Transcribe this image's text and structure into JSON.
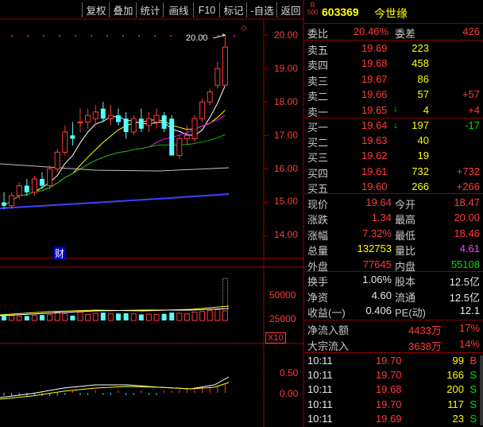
{
  "toolbar": {
    "items": [
      "复权",
      "叠加",
      "统计",
      "画线",
      "F10",
      "标记",
      "-自选",
      "返回"
    ]
  },
  "stock": {
    "badge_top": "R",
    "badge_bottom": "500",
    "code": "603369",
    "name": "今世缘"
  },
  "chart": {
    "price_axis": [
      "20.00",
      "19.00",
      "18.00",
      "17.00",
      "16.00",
      "15.00",
      "14.00"
    ],
    "high_marker": "20.00",
    "caiwu_marker": "财",
    "volume_axis": [
      "50000",
      "25000"
    ],
    "volume_unit": "X10",
    "macd_axis": [
      "0.50",
      "0.00"
    ]
  },
  "chart_data": {
    "type": "candlestick",
    "price_ylim": [
      13.6,
      20.2
    ],
    "candles": [
      {
        "o": 15.0,
        "h": 15.3,
        "l": 14.8,
        "c": 14.9
      },
      {
        "o": 14.9,
        "h": 15.3,
        "l": 14.8,
        "c": 15.2
      },
      {
        "o": 15.2,
        "h": 15.6,
        "l": 15.1,
        "c": 15.5
      },
      {
        "o": 15.5,
        "h": 15.7,
        "l": 15.2,
        "c": 15.3
      },
      {
        "o": 15.3,
        "h": 15.8,
        "l": 15.2,
        "c": 15.7
      },
      {
        "o": 15.7,
        "h": 15.9,
        "l": 15.4,
        "c": 15.5
      },
      {
        "o": 15.5,
        "h": 16.1,
        "l": 15.4,
        "c": 16.0
      },
      {
        "o": 16.0,
        "h": 16.6,
        "l": 15.9,
        "c": 16.5
      },
      {
        "o": 16.5,
        "h": 17.3,
        "l": 16.4,
        "c": 17.1
      },
      {
        "o": 17.0,
        "h": 17.4,
        "l": 16.7,
        "c": 16.9
      },
      {
        "o": 17.4,
        "h": 17.8,
        "l": 17.1,
        "c": 17.4
      },
      {
        "o": 17.4,
        "h": 17.8,
        "l": 17.2,
        "c": 17.6
      },
      {
        "o": 17.5,
        "h": 17.9,
        "l": 17.3,
        "c": 17.7
      },
      {
        "o": 17.8,
        "h": 18.0,
        "l": 17.4,
        "c": 17.5
      },
      {
        "o": 17.5,
        "h": 17.9,
        "l": 17.3,
        "c": 17.6
      },
      {
        "o": 17.6,
        "h": 17.8,
        "l": 17.3,
        "c": 17.4
      },
      {
        "o": 17.5,
        "h": 17.7,
        "l": 16.9,
        "c": 17.1
      },
      {
        "o": 17.1,
        "h": 17.6,
        "l": 17.0,
        "c": 17.5
      },
      {
        "o": 17.5,
        "h": 17.8,
        "l": 17.1,
        "c": 17.2
      },
      {
        "o": 17.3,
        "h": 17.7,
        "l": 17.1,
        "c": 17.5
      },
      {
        "o": 17.4,
        "h": 17.8,
        "l": 17.2,
        "c": 17.6
      },
      {
        "o": 17.6,
        "h": 17.7,
        "l": 17.1,
        "c": 17.2
      },
      {
        "o": 17.5,
        "h": 17.6,
        "l": 16.4,
        "c": 16.4
      },
      {
        "o": 16.4,
        "h": 17.0,
        "l": 16.3,
        "c": 16.9
      },
      {
        "o": 16.9,
        "h": 17.3,
        "l": 16.7,
        "c": 17.0
      },
      {
        "o": 16.9,
        "h": 17.6,
        "l": 16.8,
        "c": 17.5
      },
      {
        "o": 17.5,
        "h": 18.1,
        "l": 17.4,
        "c": 18.0
      },
      {
        "o": 18.0,
        "h": 18.4,
        "l": 17.9,
        "c": 18.3
      },
      {
        "o": 18.5,
        "h": 19.2,
        "l": 18.4,
        "c": 19.0
      },
      {
        "o": 18.5,
        "h": 20.0,
        "l": 18.46,
        "c": 19.64
      }
    ],
    "volumes": [
      7500,
      8000,
      7000,
      7500,
      8500,
      9000,
      9500,
      14000,
      11500,
      8000,
      14000,
      10000,
      12000,
      13000,
      11000,
      11500,
      12000,
      11000,
      10000,
      10500,
      9800,
      11000,
      13000,
      12000,
      11000,
      14000,
      15000,
      17000,
      18000,
      70000
    ],
    "volume_ylim": [
      0,
      80000
    ],
    "macd_ylim": [
      -0.3,
      0.8
    ]
  },
  "quote": {
    "weibi": {
      "label": "委比",
      "value": "20.46%",
      "label2": "委差",
      "value2": "426"
    },
    "asks": [
      {
        "label": "卖五",
        "price": "19.69",
        "vol": "223",
        "chg": ""
      },
      {
        "label": "卖四",
        "price": "19.68",
        "vol": "458",
        "chg": ""
      },
      {
        "label": "卖三",
        "price": "19.67",
        "vol": "86",
        "chg": ""
      },
      {
        "label": "卖二",
        "price": "19.66",
        "vol": "57",
        "chg": "+57"
      },
      {
        "label": "卖一",
        "price": "19.65",
        "vol": "4",
        "chg": "+4"
      }
    ],
    "bids": [
      {
        "label": "买一",
        "price": "19.64",
        "vol": "197",
        "chg": "-17"
      },
      {
        "label": "买二",
        "price": "19.63",
        "vol": "40",
        "chg": ""
      },
      {
        "label": "买三",
        "price": "19.62",
        "vol": "19",
        "chg": ""
      },
      {
        "label": "买四",
        "price": "19.61",
        "vol": "732",
        "chg": "+732"
      },
      {
        "label": "买五",
        "price": "19.60",
        "vol": "266",
        "chg": "+266"
      }
    ],
    "stats1": [
      {
        "l1": "现价",
        "v1": "19.64",
        "l2": "今开",
        "v2": "18.47"
      },
      {
        "l1": "涨跌",
        "v1": "1.34",
        "l2": "最高",
        "v2": "20.00"
      },
      {
        "l1": "涨幅",
        "v1": "7.32%",
        "l2": "最低",
        "v2": "18.46"
      },
      {
        "l1": "总量",
        "v1": "132753",
        "l2": "量比",
        "v2": "4.61"
      },
      {
        "l1": "外盘",
        "v1": "77645",
        "l2": "内盘",
        "v2": "55108"
      }
    ],
    "stats2": [
      {
        "l1": "换手",
        "v1": "1.06%",
        "l2": "股本",
        "v2": "12.5亿"
      },
      {
        "l1": "净资",
        "v1": "4.60",
        "l2": "流通",
        "v2": "12.5亿"
      },
      {
        "l1": "收益(一)",
        "v1": "0.406",
        "l2": "PE(动)",
        "v2": "12.1"
      }
    ],
    "flow": [
      {
        "label": "净流入额",
        "value": "4433万",
        "pct": "17%"
      },
      {
        "label": "大宗流入",
        "value": "3638万",
        "pct": "14%"
      }
    ],
    "ticks": [
      {
        "time": "10:11",
        "price": "19.70",
        "vol": "99",
        "side": "B"
      },
      {
        "time": "10:11",
        "price": "19.70",
        "vol": "166",
        "side": "S"
      },
      {
        "time": "10:11",
        "price": "19.68",
        "vol": "200",
        "side": "S"
      },
      {
        "time": "10:11",
        "price": "19.70",
        "vol": "117",
        "side": "S"
      },
      {
        "time": "10:11",
        "price": "19.69",
        "vol": "23",
        "side": "S"
      }
    ]
  }
}
